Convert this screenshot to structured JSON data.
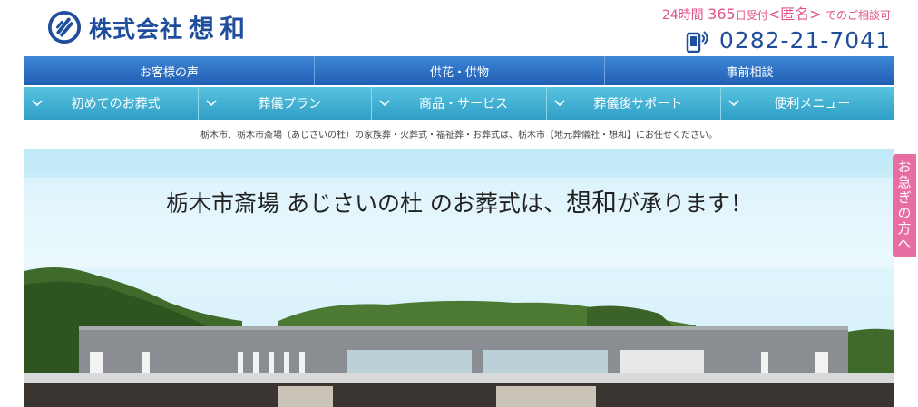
{
  "header": {
    "logo": {
      "company": "株式会社",
      "brand": "想和"
    },
    "contact": {
      "t1": "24時間",
      "t2": "365",
      "t3": "日受付",
      "t4": "<匿名>",
      "t5": "でのご相談可",
      "phone": "0282-21-7041"
    }
  },
  "nav_primary": [
    {
      "label": "お客様の声"
    },
    {
      "label": "供花・供物"
    },
    {
      "label": "事前相談"
    }
  ],
  "nav_secondary": [
    {
      "label": "初めてのお葬式"
    },
    {
      "label": "葬儀プラン"
    },
    {
      "label": "商品・サービス"
    },
    {
      "label": "葬儀後サポート"
    },
    {
      "label": "便利メニュー"
    }
  ],
  "caption": "栃木市、栃木市斎場（あじさいの杜）の家族葬・火葬式・福祉葬・お葬式は、栃木市【地元葬儀社・想和】にお任せください。",
  "hero": {
    "title_pre": "栃木市斎場 あじさいの杜 のお葬式は、",
    "title_brand": "想和",
    "title_post": "が承ります！"
  },
  "side_tab": {
    "label": "お急ぎの方へ"
  },
  "colors": {
    "brand_blue": "#1e4e9c",
    "nav_primary": "#2a6cc2",
    "nav_secondary": "#3fb0d4",
    "accent_pink": "#e0538a"
  }
}
